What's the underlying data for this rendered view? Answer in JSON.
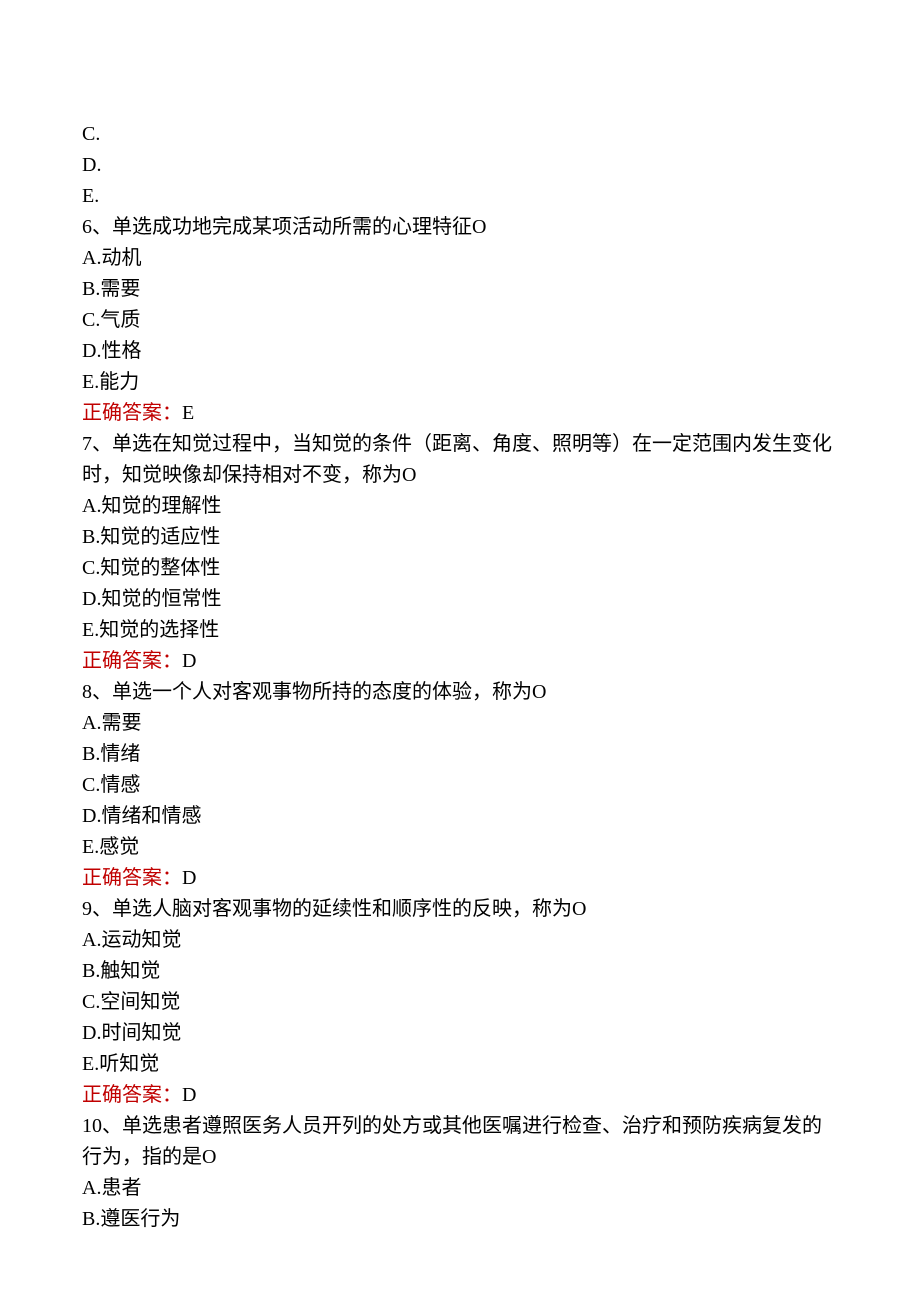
{
  "lines": {
    "l1": "C.",
    "l2": "D.",
    "l3": "E.",
    "l4": "6、单选成功地完成某项活动所需的心理特征O",
    "l5": "A.动机",
    "l6": "B.需要",
    "l7": "C.气质",
    "l8": "D.性格",
    "l9": "E.能力",
    "a1_label": "正确答案：",
    "a1_value": "E",
    "l10": "7、单选在知觉过程中，当知觉的条件（距离、角度、照明等）在一定范围内发生变化时，知觉映像却保持相对不变，称为O",
    "l11": "A.知觉的理解性",
    "l12": "B.知觉的适应性",
    "l13": "C.知觉的整体性",
    "l14": "D.知觉的恒常性",
    "l15": "E.知觉的选择性",
    "a2_label": "正确答案：",
    "a2_value": "D",
    "l16": "8、单选一个人对客观事物所持的态度的体验，称为O",
    "l17": "A.需要",
    "l18": "B.情绪",
    "l19": "C.情感",
    "l20": "D.情绪和情感",
    "l21": "E.感觉",
    "a3_label": "正确答案：",
    "a3_value": "D",
    "l22": "9、单选人脑对客观事物的延续性和顺序性的反映，称为O",
    "l23": "A.运动知觉",
    "l24": "B.触知觉",
    "l25": "C.空间知觉",
    "l26": "D.时间知觉",
    "l27": "E.听知觉",
    "a4_label": "正确答案：",
    "a4_value": "D",
    "l28": "10、单选患者遵照医务人员开列的处方或其他医嘱进行检查、治疗和预防疾病复发的行为，指的是O",
    "l29": "A.患者",
    "l30": "B.遵医行为"
  }
}
